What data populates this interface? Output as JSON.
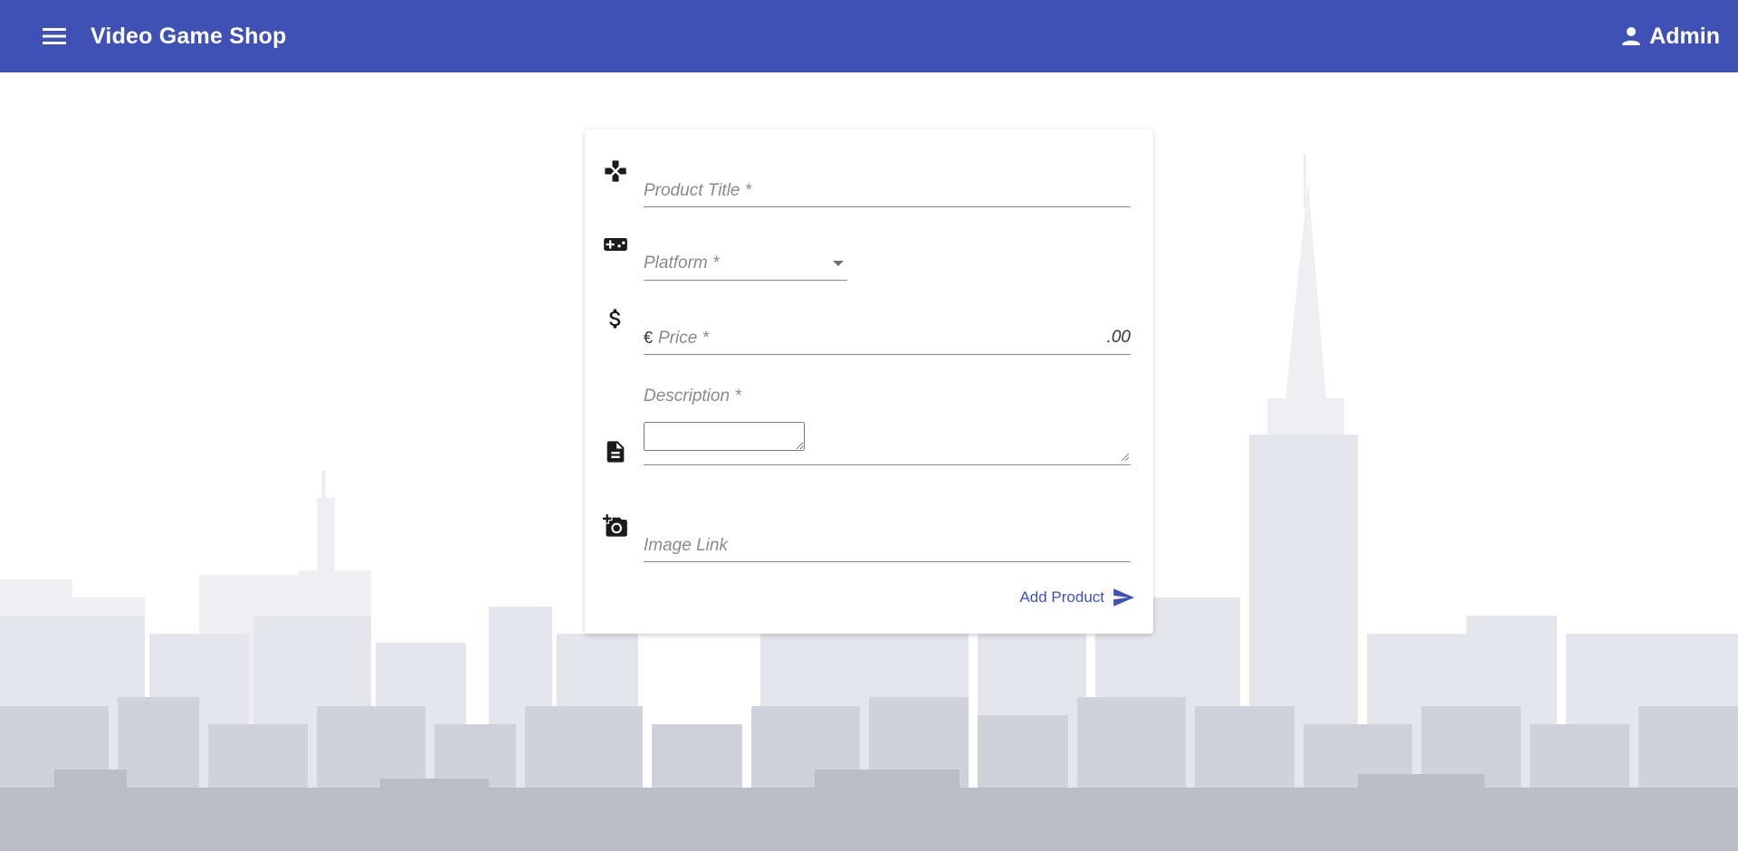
{
  "app": {
    "title": "Video Game Shop",
    "user_label": "Admin",
    "brand_color": "#3f51b5"
  },
  "icons": {
    "menu": "menu-icon",
    "user": "person-icon",
    "title_field": "gamepad-icon",
    "platform_field": "videogame-asset-icon",
    "price_field": "dollar-icon",
    "description_field": "document-icon",
    "image_field": "add-a-photo-icon",
    "submit": "send-icon"
  },
  "form": {
    "title_placeholder": "Product Title *",
    "platform_placeholder": "Platform *",
    "price_prefix": "€",
    "price_placeholder": "Price *",
    "price_suffix": ".00",
    "description_label": "Description *",
    "image_placeholder": "Image Link",
    "submit_label": "Add Product"
  }
}
